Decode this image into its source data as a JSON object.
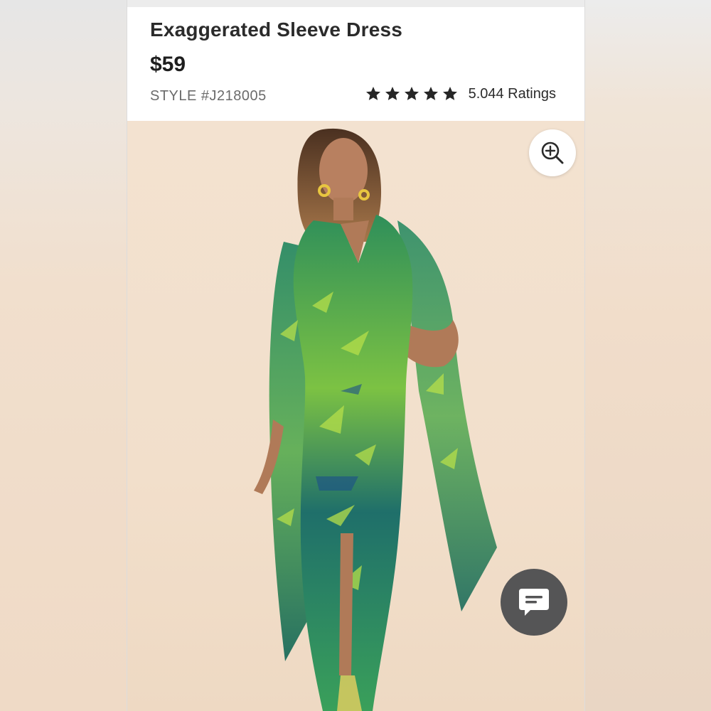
{
  "product": {
    "title": "Exaggerated Sleeve Dress",
    "price": "$59",
    "style": "STYLE #J218005",
    "rating": {
      "stars": 5,
      "text": "5.044 Ratings"
    }
  },
  "icons": {
    "zoom": "zoom-in-icon",
    "chat": "chat-icon",
    "star": "star-icon"
  },
  "colors": {
    "text": "#2b2b2b",
    "chat_bg": "#555556",
    "image_bg": "#f2dfcb"
  }
}
